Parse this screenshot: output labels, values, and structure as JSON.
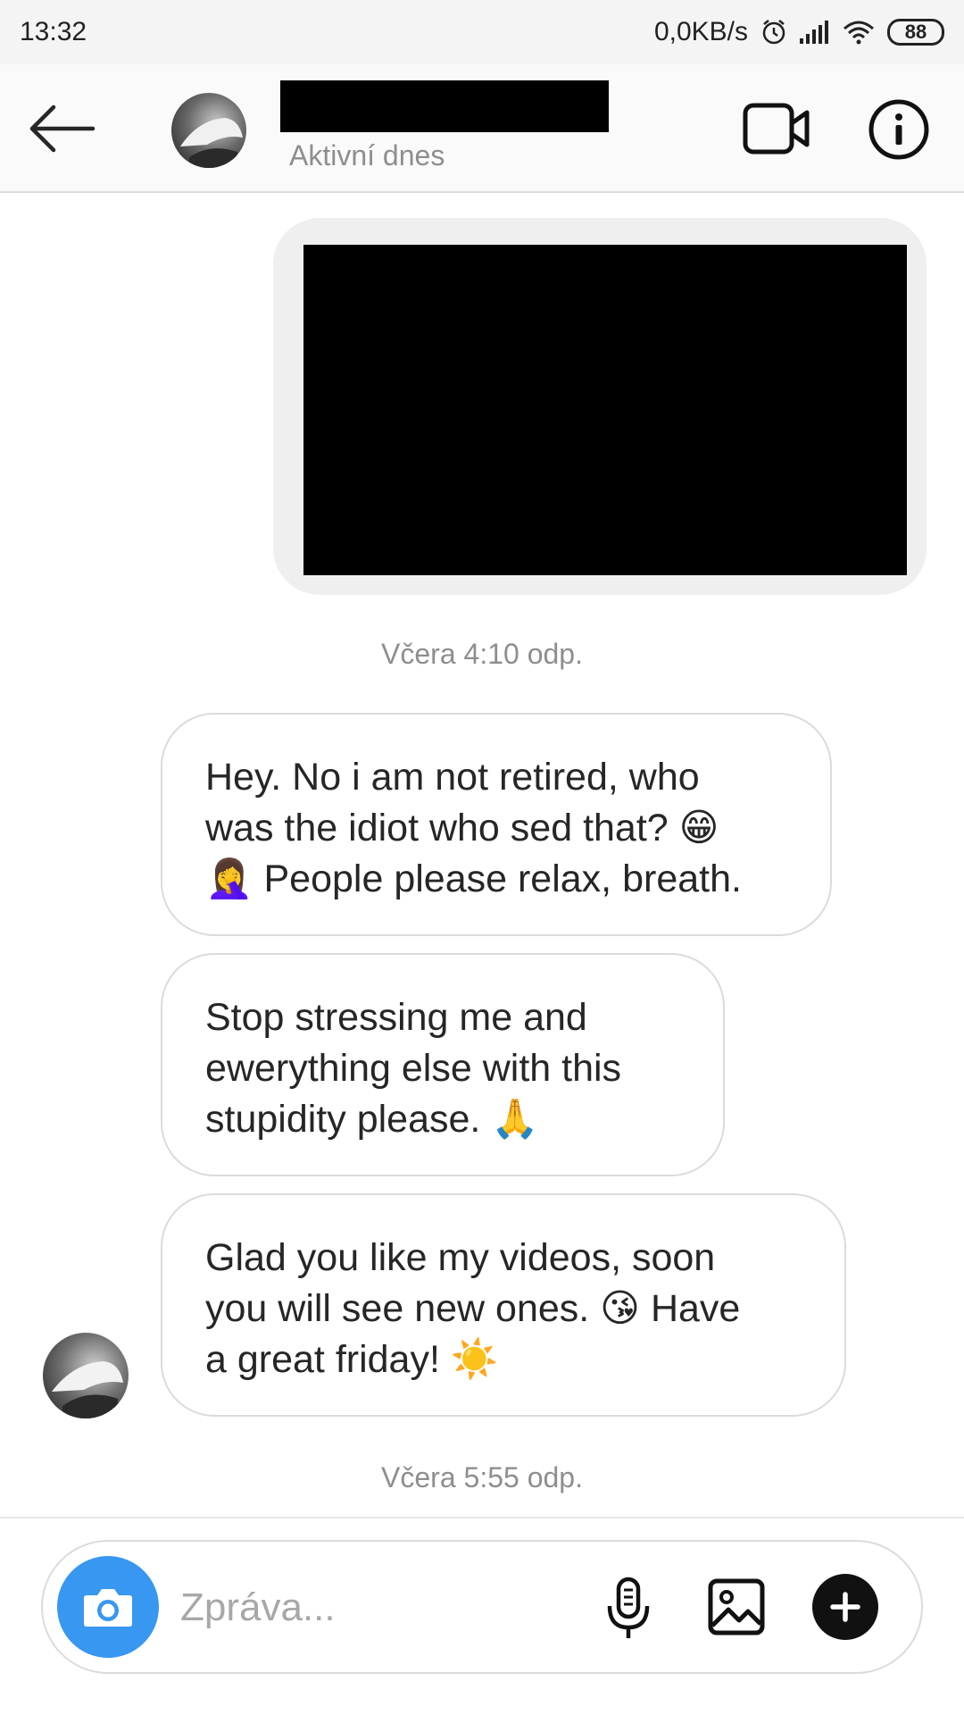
{
  "status_bar": {
    "time": "13:32",
    "net_speed": "0,0KB/s",
    "battery": "88",
    "icons": [
      "alarm-icon",
      "signal-icon",
      "wifi-icon",
      "battery-icon"
    ]
  },
  "header": {
    "status": "Aktivní dnes",
    "icons": [
      "back-arrow-icon",
      "video-call-icon",
      "info-icon"
    ]
  },
  "messages": {
    "timestamp_1": "Včera 4:10 odp.",
    "bubble_1": "Hey. No i am not retired, who\nwas the idiot who sed that? 😁\n🤦‍♀️ People please relax, breath.",
    "bubble_2": "Stop stressing me and\newerything else with this\nstupidity please. 🙏",
    "bubble_3": "Glad you like my videos, soon\nyou will see new ones. 😘 Have\na great friday! ☀️",
    "timestamp_2": "Včera 5:55 odp."
  },
  "composer": {
    "placeholder": "Zpráva...",
    "value": "",
    "icons": [
      "camera-icon",
      "microphone-icon",
      "gallery-icon",
      "plus-icon"
    ]
  },
  "colors": {
    "accent": "#3897f0",
    "bubble_border": "#dbdbdb",
    "media_bubble": "#efefef",
    "secondary_text": "#8e8e8e"
  }
}
